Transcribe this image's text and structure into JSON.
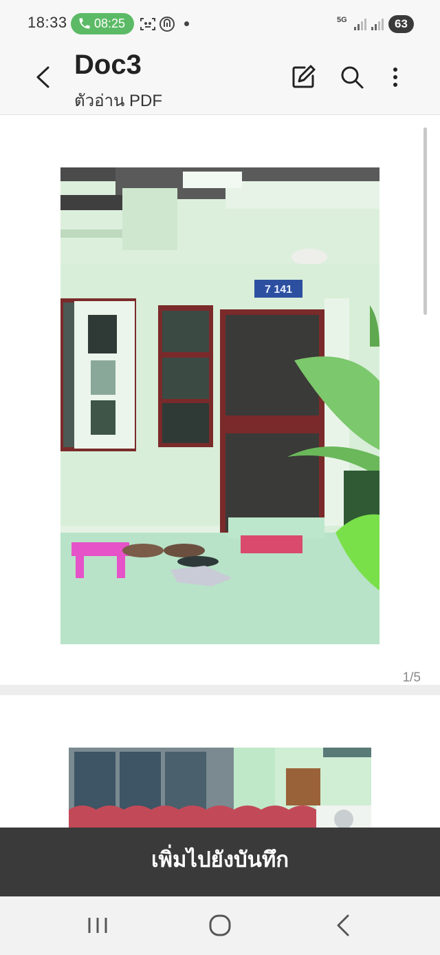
{
  "status_bar": {
    "time": "18:33",
    "call_duration": "08:25",
    "network": "5G",
    "battery": "63"
  },
  "header": {
    "title": "Doc3",
    "subtitle": "ตัวอ่าน PDF"
  },
  "document": {
    "page_indicator": "1/5",
    "house_number_sign": "7 141"
  },
  "bottom_action": {
    "label": "เพิ่มไปยังบันทึก"
  },
  "colors": {
    "call_pill": "#5cba66",
    "action_bar": "#3a3a3a",
    "wall_tint": "#d6ecd6"
  },
  "icons": [
    "back-arrow-icon",
    "edit-icon",
    "search-icon",
    "more-options-icon",
    "recents-icon",
    "home-icon",
    "nav-back-icon"
  ]
}
